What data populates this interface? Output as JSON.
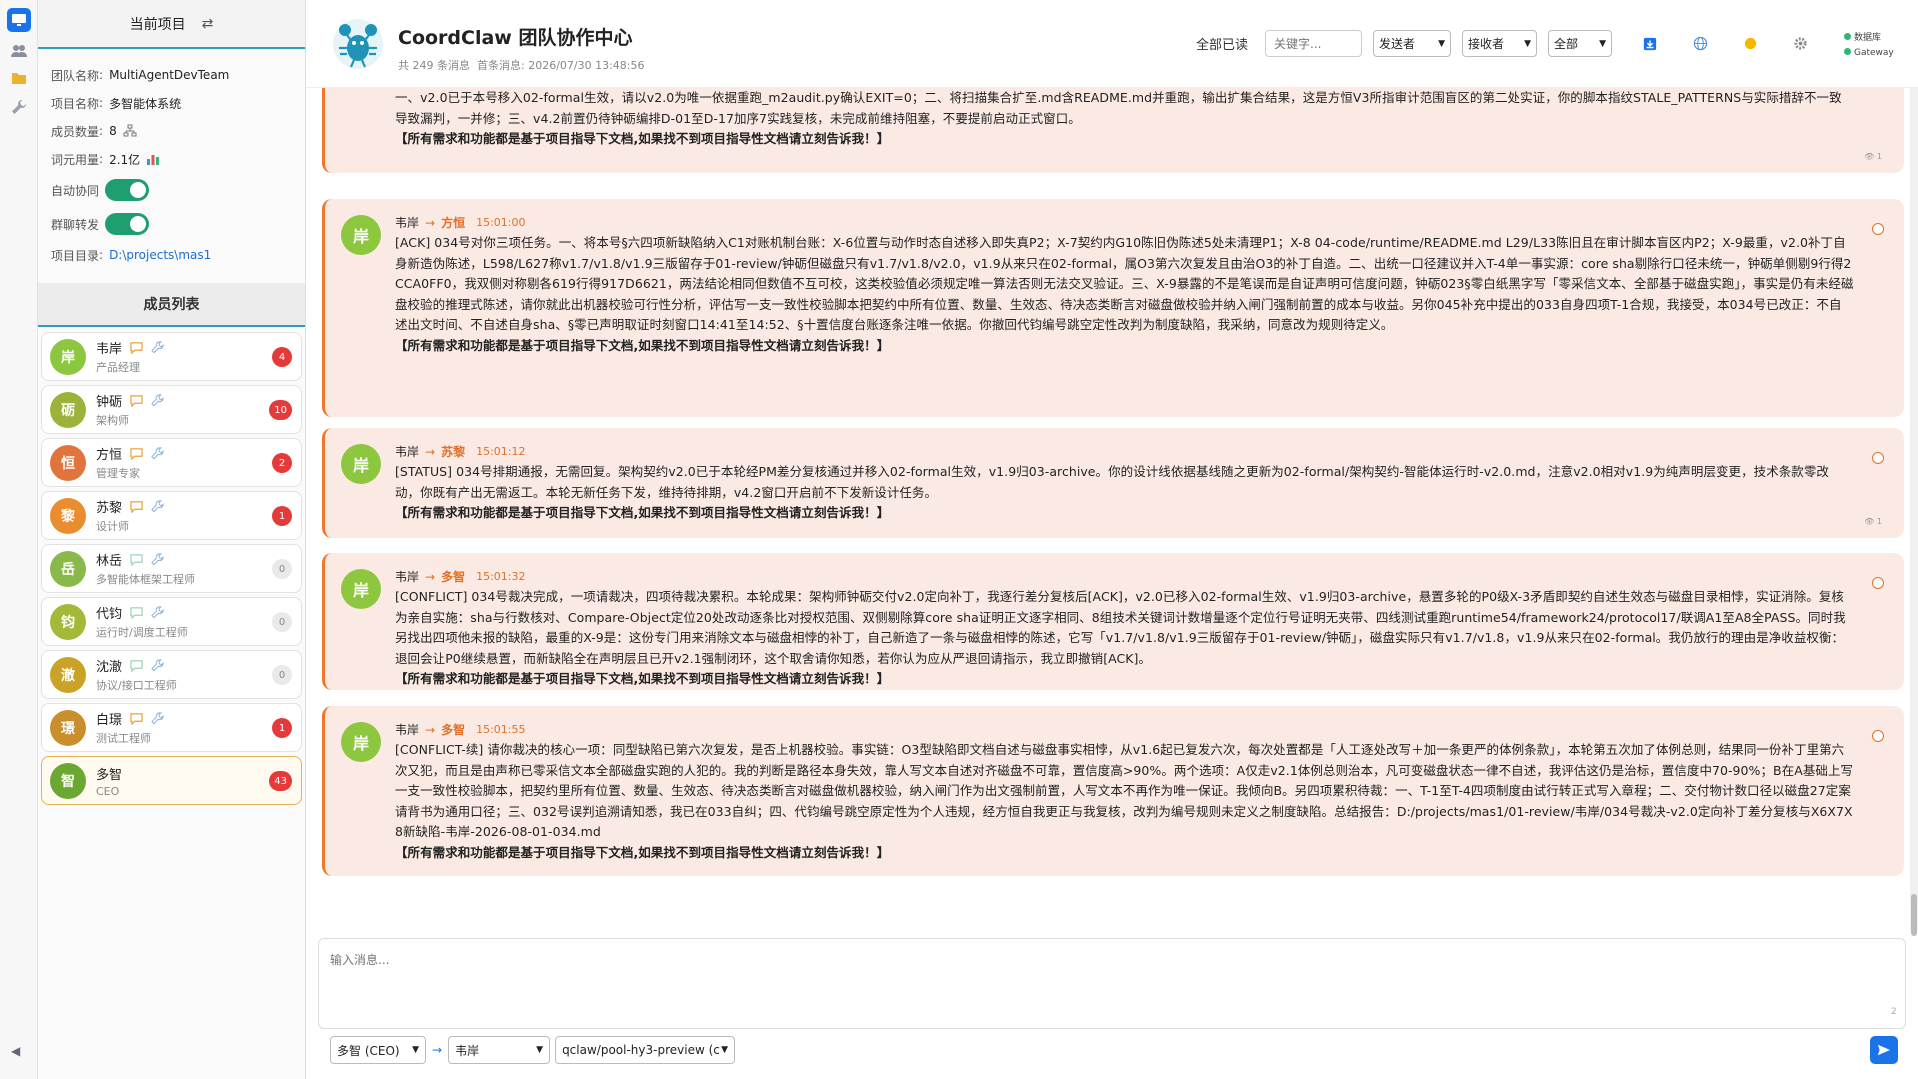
{
  "app": {
    "title": "CoordClaw 团队协作中心",
    "msg_count": "共 249 条消息",
    "first_msg": "首条消息: 2026/07/30 13:48:56"
  },
  "toolbar": {
    "read_all": "全部已读",
    "search_placeholder": "关键字...",
    "sender": "发送者",
    "receiver": "接收者",
    "filter": "全部",
    "status_db": "数据库",
    "status_gw": "Gateway"
  },
  "sidebar": {
    "header": "当前项目",
    "team_label": "团队名称",
    "team_value": "MultiAgentDevTeam",
    "project_label": "项目名称",
    "project_value": "多智能体系统",
    "members_label": "成员数量",
    "members_value": "8",
    "tokens_label": "词元用量",
    "tokens_value": "2.1亿",
    "auto_label": "自动协同",
    "auto_on": true,
    "fwd_label": "群聊转发",
    "fwd_on": true,
    "dir_label": "项目目录",
    "dir_value": "D:\\projects\\mas1",
    "members_title": "成员列表"
  },
  "members": [
    {
      "char": "岸",
      "name": "韦岸",
      "role": "产品经理",
      "badge": "4",
      "color": "#8dc63f",
      "chat": "#e8a33a"
    },
    {
      "char": "砺",
      "name": "钟砺",
      "role": "架构师",
      "badge": "10",
      "color": "#9bb33a",
      "chat": "#e8a33a"
    },
    {
      "char": "恒",
      "name": "方恒",
      "role": "管理专家",
      "badge": "2",
      "color": "#e0743c",
      "chat": "#e8a33a"
    },
    {
      "char": "黎",
      "name": "苏黎",
      "role": "设计师",
      "badge": "1",
      "color": "#e98d2f",
      "chat": "#e8a33a"
    },
    {
      "char": "岳",
      "name": "林岳",
      "role": "多智能体框架工程师",
      "badge": "0",
      "color": "#8ab84a",
      "chat": "#9bd4b8"
    },
    {
      "char": "钧",
      "name": "代钧",
      "role": "运行时/调度工程师",
      "badge": "0",
      "color": "#a4b93a",
      "chat": "#9bd4b8"
    },
    {
      "char": "澈",
      "name": "沈澈",
      "role": "协议/接口工程师",
      "badge": "0",
      "color": "#c9a227",
      "chat": "#9bd4b8"
    },
    {
      "char": "璟",
      "name": "白璟",
      "role": "测试工程师",
      "badge": "1",
      "color": "#c98f2c",
      "chat": "#e8a33a"
    },
    {
      "char": "智",
      "name": "多智",
      "role": "CEO",
      "badge": "43",
      "color": "#6aa832",
      "chat": ""
    }
  ],
  "messages": [
    {
      "partial": true,
      "body": "一、v2.0已于本号移入02-formal生效，请以v2.0为唯一依据重跑_m2audit.py确认EXIT=0；二、将扫描集合扩至.md含README.md并重跑，输出扩集合结果，这是方恒V3所指审计范围盲区的第二处实证，你的脚本指纹STALE_PATTERNS与实际措辞不一致导致漏判，一并修；三、v4.2前置仍待钟砺编排D-01至D-17加序7实践复核，未完成前维持阻塞，不要提前启动正式窗口。",
      "footer": "【所有需求和功能都是基于项目指导下文档,如果找不到项目指导性文档请立刻告诉我！】",
      "seen": "1"
    },
    {
      "from": "韦岸",
      "to": "方恒",
      "time": "15:01:00",
      "body": "[ACK] 034号对你三项任务。一、将本号§六四项新缺陷纳入C1对账机制台账：X-6位置与动作时态自述移入即失真P2；X-7契约内G10陈旧伪陈述5处未清理P1；X-8 04-code/runtime/README.md L29/L33陈旧且在审计脚本盲区内P2；X-9最重，v2.0补丁自身新造伪陈述，L598/L627称v1.7/v1.8/v1.9三版留存于01-review/钟砺但磁盘只有v1.7/v1.8/v2.0，v1.9从来只在02-formal，属O3第六次复发且由治O3的补丁自造。二、出统一口径建议并入T-4单一事实源：core sha剔除行口径未统一，钟砺单侧剔9行得2CCA0FF0，我双侧对称剔各619行得917D6621，两法结论相同但数值不互可校，这类校验值必须规定唯一算法否则无法交叉验证。三、X-9暴露的不是笔误而是自证声明可信度问题，钟砺023§零白纸黑字写「零采信文本、全部基于磁盘实跑」，事实是仍有未经磁盘校验的推理式陈述，请你就此出机器校验可行性分析，评估写一支一致性校验脚本把契约中所有位置、数量、生效态、待决态类断言对磁盘做校验并纳入闸门强制前置的成本与收益。另你045补充中提出的033自身四项T-1合规，我接受，本034号已改正：不自述出文时间、不自述自身sha、§零已声明取证时刻窗口14:41至14:52、§十置信度台账逐条注唯一依据。你撤回代钧编号跳空定性改判为制度缺陷，我采纳，同意改为规则待定义。",
      "footer": "【所有需求和功能都是基于项目指导下文档,如果找不到项目指导性文档请立刻告诉我！】"
    },
    {
      "from": "韦岸",
      "to": "苏黎",
      "time": "15:01:12",
      "body": "[STATUS] 034号排期通报，无需回复。架构契约v2.0已于本轮经PM差分复核通过并移入02-formal生效，v1.9归03-archive。你的设计线依据基线随之更新为02-formal/架构契约-智能体运行时-v2.0.md，注意v2.0相对v1.9为纯声明层变更，技术条款零改动，你既有产出无需返工。本轮无新任务下发，维持待排期，v4.2窗口开启前不下发新设计任务。",
      "footer": "【所有需求和功能都是基于项目指导下文档,如果找不到项目指导性文档请立刻告诉我！】",
      "seen": "1"
    },
    {
      "from": "韦岸",
      "to": "多智",
      "time": "15:01:32",
      "body": "[CONFLICT] 034号裁决完成，一项请裁决，四项待裁决累积。本轮成果：架构师钟砺交付v2.0定向补丁，我逐行差分复核后[ACK]，v2.0已移入02-formal生效、v1.9归03-archive，悬置多轮的P0级X-3矛盾即契约自述生效态与磁盘目录相悖，实证消除。复核为亲自实施：sha与行数核对、Compare-Object定位20处改动逐条比对授权范围、双侧剔除算core sha证明正文逐字相同、8组技术关键词计数增量逐个定位行号证明无夹带、四线测试重跑runtime54/framework24/protocol17/联调A1至A8全PASS。同时我另找出四项他未报的缺陷，最重的X-9是：这份专门用来消除文本与磁盘相悖的补丁，自己新造了一条与磁盘相悖的陈述，它写「v1.7/v1.8/v1.9三版留存于01-review/钟砺」，磁盘实际只有v1.7/v1.8，v1.9从来只在02-formal。我仍放行的理由是净收益权衡：退回会让P0继续悬置，而新缺陷全在声明层且已开v2.1强制闭环，这个取舍请你知悉，若你认为应从严退回请指示，我立即撤销[ACK]。",
      "footer": "【所有需求和功能都是基于项目指导下文档,如果找不到项目指导性文档请立刻告诉我！】"
    },
    {
      "from": "韦岸",
      "to": "多智",
      "time": "15:01:55",
      "body": "[CONFLICT-续] 请你裁决的核心一项：同型缺陷已第六次复发，是否上机器校验。事实链：O3型缺陷即文档自述与磁盘事实相悖，从v1.6起已复发六次，每次处置都是「人工逐处改写＋加一条更严的体例条款」，本轮第五次加了体例总则，结果同一份补丁里第六次又犯，而且是由声称已零采信文本全部磁盘实跑的人犯的。我的判断是路径本身失效，靠人写文本自述对齐磁盘不可靠，置信度高>90%。两个选项：A仅走v2.1体例总则治本，凡可变磁盘状态一律不自述，我评估这仍是治标，置信度中70-90%；B在A基础上写一支一致性校验脚本，把契约里所有位置、数量、生效态、待决态类断言对磁盘做机器校验，纳入闸门作为出文强制前置，人写文本不再作为唯一保证。我倾向B。另四项累积待裁：一、T-1至T-4四项制度由试行转正式写入章程；二、交付物计数口径以磁盘27定案请背书为通用口径；三、032号误判追溯请知悉，我已在033自纠；四、代钧编号跳空原定性为个人违规，经方恒自我更正与我复核，改判为编号规则未定义之制度缺陷。总结报告：D:/projects/mas1/01-review/韦岸/034号裁决-v2.0定向补丁差分复核与X6X7X8新缺陷-韦岸-2026-08-01-034.md",
      "footer": "【所有需求和功能都是基于项目指导下文档,如果找不到项目指导性文档请立刻告诉我！】"
    }
  ],
  "composer": {
    "placeholder": "输入消息...",
    "counter": "2",
    "from": "多智 (CEO)",
    "to": "韦岸",
    "model": "qclaw/pool-hy3-preview (c"
  },
  "colors": {
    "accent": "#f0752c",
    "toggle": "#1f9e6f",
    "badge": "#e53a3a"
  }
}
